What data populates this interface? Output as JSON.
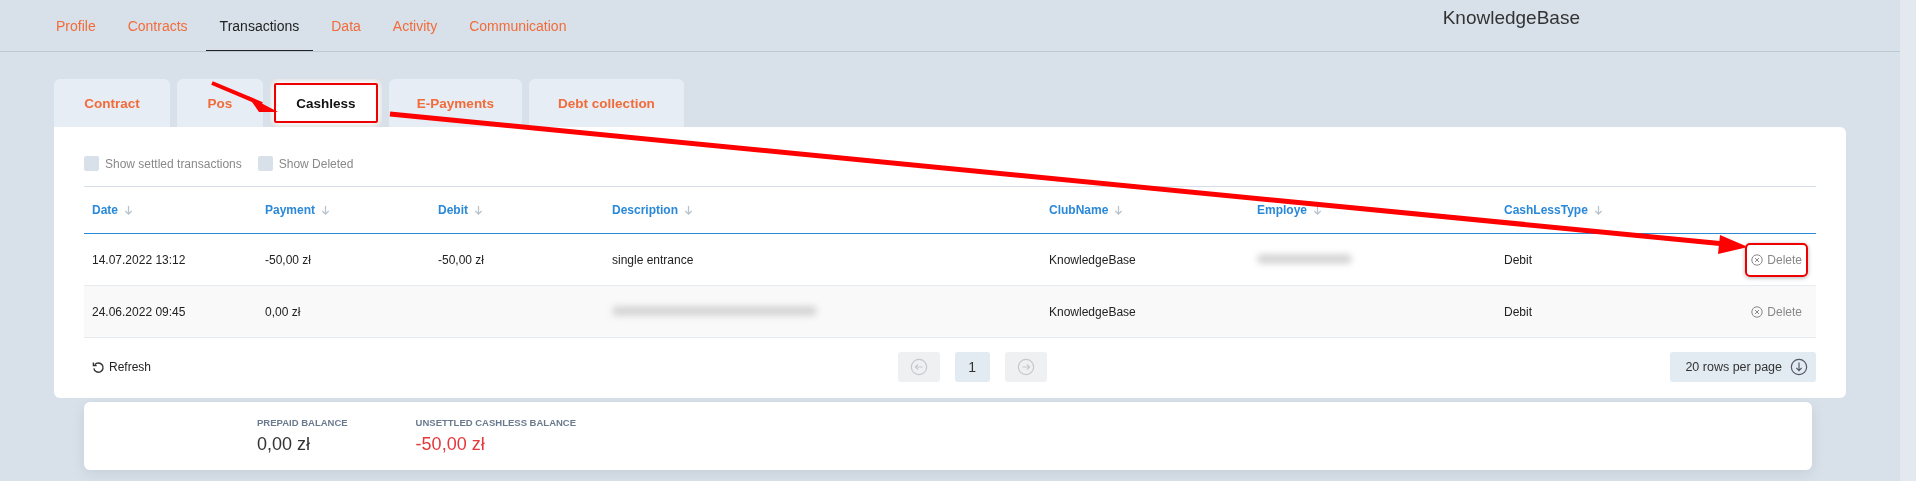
{
  "nav": [
    {
      "label": "Profile",
      "selected": false
    },
    {
      "label": "Contracts",
      "selected": false
    },
    {
      "label": "Transactions",
      "selected": true
    },
    {
      "label": "Data",
      "selected": false
    },
    {
      "label": "Activity",
      "selected": false
    },
    {
      "label": "Communication",
      "selected": false
    }
  ],
  "home_club": {
    "value": "KnowledgeBase"
  },
  "tabs": [
    {
      "label": "Contract",
      "selected": false,
      "annotated": false
    },
    {
      "label": "Pos",
      "selected": false,
      "annotated": false
    },
    {
      "label": "Cashless",
      "selected": true,
      "annotated": true
    },
    {
      "label": "E-Payments",
      "selected": false,
      "annotated": false
    },
    {
      "label": "Debt collection",
      "selected": false,
      "annotated": false
    }
  ],
  "filters": [
    {
      "label": "Show settled transactions",
      "checked": false
    },
    {
      "label": "Show Deleted",
      "checked": false
    }
  ],
  "table": {
    "columns": [
      "Date",
      "Payment",
      "Debit",
      "Description",
      "ClubName",
      "Employe",
      "CashLessType"
    ],
    "rows": [
      {
        "cells": [
          {
            "text": "14.07.2022 13:12"
          },
          {
            "text": "-50,00 zł"
          },
          {
            "text": "-50,00 zł"
          },
          {
            "text": "single entrance"
          },
          {
            "text": "KnowledgeBase"
          },
          {
            "redacted": true
          },
          {
            "text": "Debit"
          }
        ],
        "action": "Delete",
        "annotated": true
      },
      {
        "cells": [
          {
            "text": "24.06.2022 09:45"
          },
          {
            "text": "0,00 zł"
          },
          {},
          {
            "redacted": true
          },
          {
            "text": "KnowledgeBase"
          },
          {},
          {
            "text": "Debit"
          }
        ],
        "action": "Delete",
        "annotated": false
      }
    ]
  },
  "refresh": "Refresh",
  "pagination": {
    "pages": [
      {
        "label": "1",
        "selected": true
      }
    ]
  },
  "rows_per_page": "20 rows per page",
  "balances": [
    {
      "label": "PREPAID BALANCE",
      "value": "0,00 zł",
      "negative": false
    },
    {
      "label": "UNSETTLED CASHLESS BALANCE",
      "value": "-50,00 zł",
      "negative": true
    }
  ]
}
